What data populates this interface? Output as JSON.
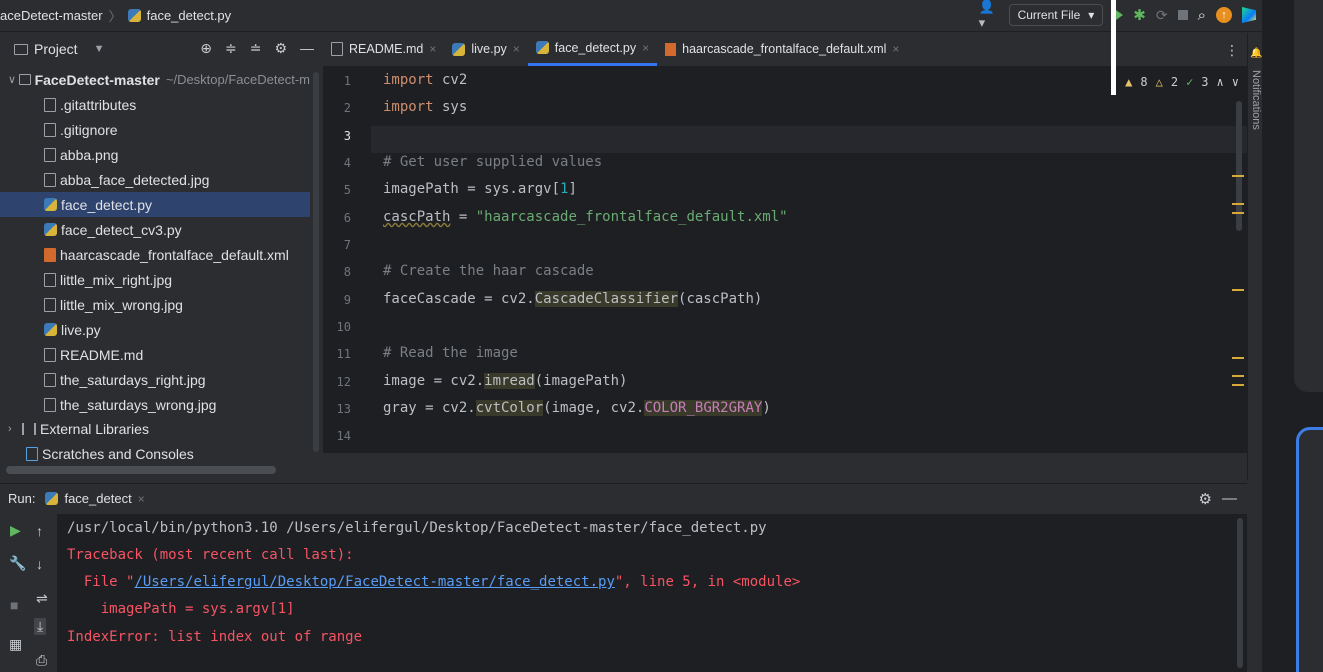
{
  "breadcrumb": {
    "project": "aceDetect-master",
    "file": "face_detect.py"
  },
  "toolbar": {
    "run_config": "Current File",
    "update_badge": "↑"
  },
  "notifications": {
    "label": "Notifications"
  },
  "project_panel": {
    "title": "Project",
    "root": {
      "name": "FaceDetect-master",
      "path": "~/Desktop/FaceDetect-m"
    },
    "files": [
      {
        "name": ".gitattributes",
        "icon": "file-icon"
      },
      {
        "name": ".gitignore",
        "icon": "gitignore-icon"
      },
      {
        "name": "abba.png",
        "icon": "image-icon"
      },
      {
        "name": "abba_face_detected.jpg",
        "icon": "image-icon"
      },
      {
        "name": "face_detect.py",
        "icon": "python-icon"
      },
      {
        "name": "face_detect_cv3.py",
        "icon": "python-icon"
      },
      {
        "name": "haarcascade_frontalface_default.xml",
        "icon": "xml-icon"
      },
      {
        "name": "little_mix_right.jpg",
        "icon": "image-icon"
      },
      {
        "name": "little_mix_wrong.jpg",
        "icon": "image-icon"
      },
      {
        "name": "live.py",
        "icon": "python-icon"
      },
      {
        "name": "README.md",
        "icon": "markdown-icon"
      },
      {
        "name": "the_saturdays_right.jpg",
        "icon": "image-icon"
      },
      {
        "name": "the_saturdays_wrong.jpg",
        "icon": "image-icon"
      }
    ],
    "selected_file": "face_detect.py",
    "external_libraries": "External Libraries",
    "scratches": "Scratches and Consoles"
  },
  "editor_tabs": [
    {
      "label": "README.md",
      "active": false
    },
    {
      "label": "live.py",
      "active": false
    },
    {
      "label": "face_detect.py",
      "active": true
    },
    {
      "label": "haarcascade_frontalface_default.xml",
      "active": false
    }
  ],
  "inspections": {
    "warnings": "8",
    "weak_warnings": "2",
    "typos": "3"
  },
  "editor": {
    "current_line": 3,
    "lines": [
      {
        "n": "1"
      },
      {
        "n": "2"
      },
      {
        "n": "3"
      },
      {
        "n": "4"
      },
      {
        "n": "5"
      },
      {
        "n": "6"
      },
      {
        "n": "7"
      },
      {
        "n": "8"
      },
      {
        "n": "9"
      },
      {
        "n": "10"
      },
      {
        "n": "11"
      },
      {
        "n": "12"
      },
      {
        "n": "13"
      },
      {
        "n": "14"
      }
    ],
    "code": {
      "l1_kw": "import",
      "l1_rest": " cv2",
      "l2_kw": "import",
      "l2_rest": " sys",
      "l4": "# Get user supplied values",
      "l5_a": "imagePath = sys.argv[",
      "l5_num": "1",
      "l5_b": "]",
      "l6_a": "cascPath",
      "l6_b": " = ",
      "l6_str": "\"haarcascade_frontalface_default.xml\"",
      "l8": "# Create the haar cascade",
      "l9_a": "faceCascade = cv2.",
      "l9_fn": "CascadeClassifier",
      "l9_b": "(cascPath)",
      "l11": "# Read the image",
      "l12_a": "image = cv2.",
      "l12_fn": "imread",
      "l12_b": "(imagePath)",
      "l13_a": "gray = cv2.",
      "l13_fn": "cvtColor",
      "l13_b": "(image, cv2.",
      "l13_const": "COLOR_BGR2GRAY",
      "l13_c": ")"
    }
  },
  "run_panel": {
    "label": "Run:",
    "tab": "face_detect",
    "output": {
      "cmd": "/usr/local/bin/python3.10 /Users/elifergul/Desktop/FaceDetect-master/face_detect.py",
      "traceback": "Traceback (most recent call last):",
      "file_prefix": "  File \"",
      "file_link": "/Users/elifergul/Desktop/FaceDetect-master/face_detect.py",
      "file_suffix": "\", line 5, in <module>",
      "code_line": "    imagePath = sys.argv[1]",
      "error": "IndexError: list index out of range"
    }
  },
  "colors": {
    "accent": "#3574f0",
    "selection": "#2e436e",
    "error": "#f75464",
    "link": "#589df6"
  }
}
